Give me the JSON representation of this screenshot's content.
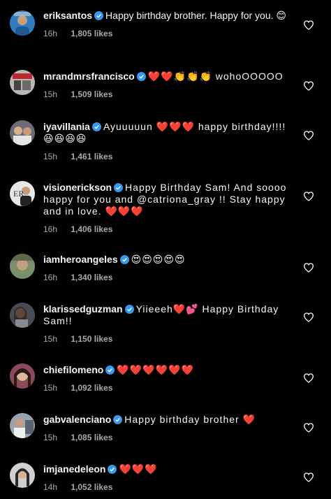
{
  "comments": [
    {
      "username": "eriksantos",
      "text": "Happy birthday brother. Happy for you. 😊",
      "time": "16h",
      "likes": "1,805 likes",
      "avatar_color": "#2f7fbf"
    },
    {
      "username": "mrandmrsfrancisco",
      "text": "❤️❤️👏👏👏 wohoOOOOO",
      "time": "15h",
      "likes": "1,509 likes",
      "avatar_color": "#b8b8b8"
    },
    {
      "username": "iyavillania",
      "text": "Ayuuuuun ❤️❤️❤️ happy birthday!!!! 😆😆😆😆",
      "time": "15h",
      "likes": "1,461 likes",
      "avatar_color": "#6a6a7a"
    },
    {
      "username": "visionerickson",
      "text": "Happy Birthday Sam! And soooo happy for you and @catriona_gray !! Stay happy and in love. ❤️❤️❤️",
      "time": "16h",
      "likes": "1,406 likes",
      "avatar_color": "#e8e8e8"
    },
    {
      "username": "iamheroangeles",
      "text": "😍😍😍😍😍",
      "time": "16h",
      "likes": "1,340 likes",
      "avatar_color": "#7a8f6a"
    },
    {
      "username": "klarissedguzman",
      "text": "Yiieeeh❤️💕 Happy Birthday Sam!!",
      "time": "15h",
      "likes": "1,150 likes",
      "avatar_color": "#4a4a55"
    },
    {
      "username": "chiefilomeno",
      "text": "❤️❤️❤️❤️❤️❤️",
      "time": "15h",
      "likes": "1,092 likes",
      "avatar_color": "#8a4a5a"
    },
    {
      "username": "gabvalenciano",
      "text": "Happy birthday brother ❤️",
      "time": "15h",
      "likes": "1,085 likes",
      "avatar_color": "#9aa3b0"
    },
    {
      "username": "imjanedeleon",
      "text": "❤️❤️❤️",
      "time": "14h",
      "likes": "1,052 likes",
      "avatar_color": "#d0d0d0"
    }
  ],
  "icons": {
    "verified": "verified-badge-icon",
    "like": "heart-outline-icon"
  },
  "colors": {
    "background": "#000000",
    "text": "#f5f5f5",
    "meta": "#a8a8a8",
    "verified": "#3897f0"
  }
}
